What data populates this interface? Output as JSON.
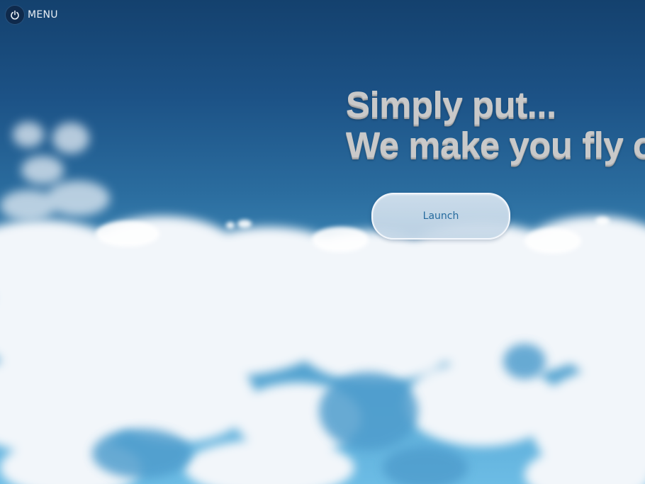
{
  "menu": {
    "icon": "power-icon",
    "label": "MENU"
  },
  "hero": {
    "headline_line1": "Simply put...",
    "headline_line2": "We make you fly o"
  },
  "launch": {
    "label": "Launch"
  },
  "colors": {
    "sky_top": "#14416e",
    "sky_bottom": "#6cbce5",
    "headline": "#c9c9c9",
    "button_text": "#256a9d"
  }
}
